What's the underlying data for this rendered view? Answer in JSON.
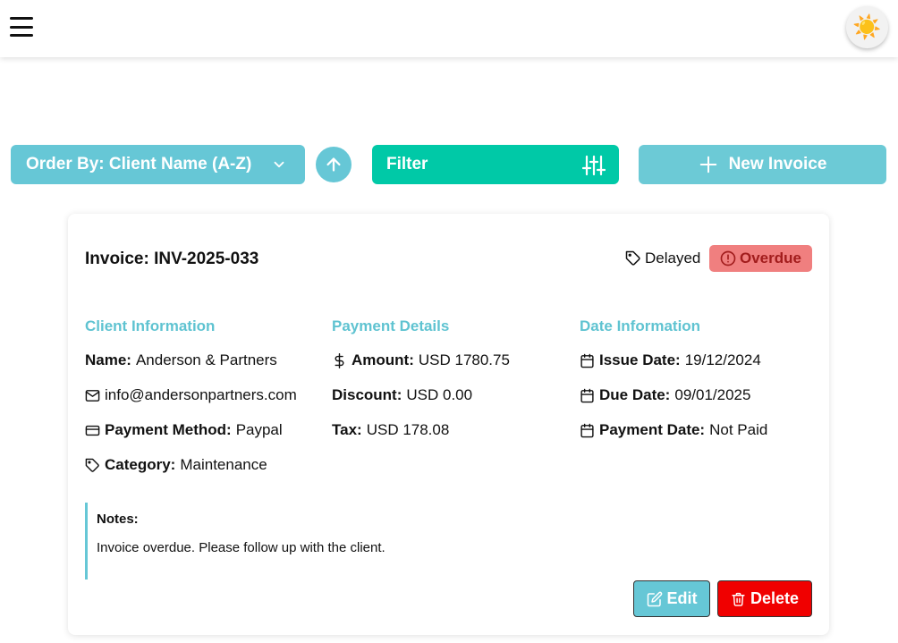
{
  "header": {
    "menu_icon": "hamburger-icon",
    "theme_icon": "sun-icon",
    "theme_glyph": "☀️"
  },
  "toolbar": {
    "order_label": "Order By: Client Name (A-Z)",
    "filter_label": "Filter",
    "new_invoice_label": "New Invoice"
  },
  "invoice": {
    "title": "Invoice: INV-2025-033",
    "tag": "Delayed",
    "status": "Overdue",
    "client": {
      "heading": "Client Information",
      "name_label": "Name:",
      "name": "Anderson & Partners",
      "email": "info@andersonpartners.com",
      "payment_method_label": "Payment Method:",
      "payment_method": "Paypal",
      "category_label": "Category:",
      "category": "Maintenance"
    },
    "payment": {
      "heading": "Payment Details",
      "amount_label": "Amount:",
      "amount": "USD 1780.75",
      "discount_label": "Discount:",
      "discount": "USD 0.00",
      "tax_label": "Tax:",
      "tax": "USD 178.08"
    },
    "dates": {
      "heading": "Date Information",
      "issue_label": "Issue Date:",
      "issue": "19/12/2024",
      "due_label": "Due Date:",
      "due": "09/01/2025",
      "payment_label": "Payment Date:",
      "payment": "Not Paid"
    },
    "notes": {
      "heading": "Notes:",
      "text": "Invoice overdue. Please follow up with the client."
    },
    "edit_label": "Edit",
    "delete_label": "Delete"
  },
  "colors": {
    "accent": "#66c7d6",
    "filter": "#00c9a7",
    "danger": "#f00000",
    "badge_bg": "#f07f7f",
    "badge_text": "#a21d1d"
  }
}
